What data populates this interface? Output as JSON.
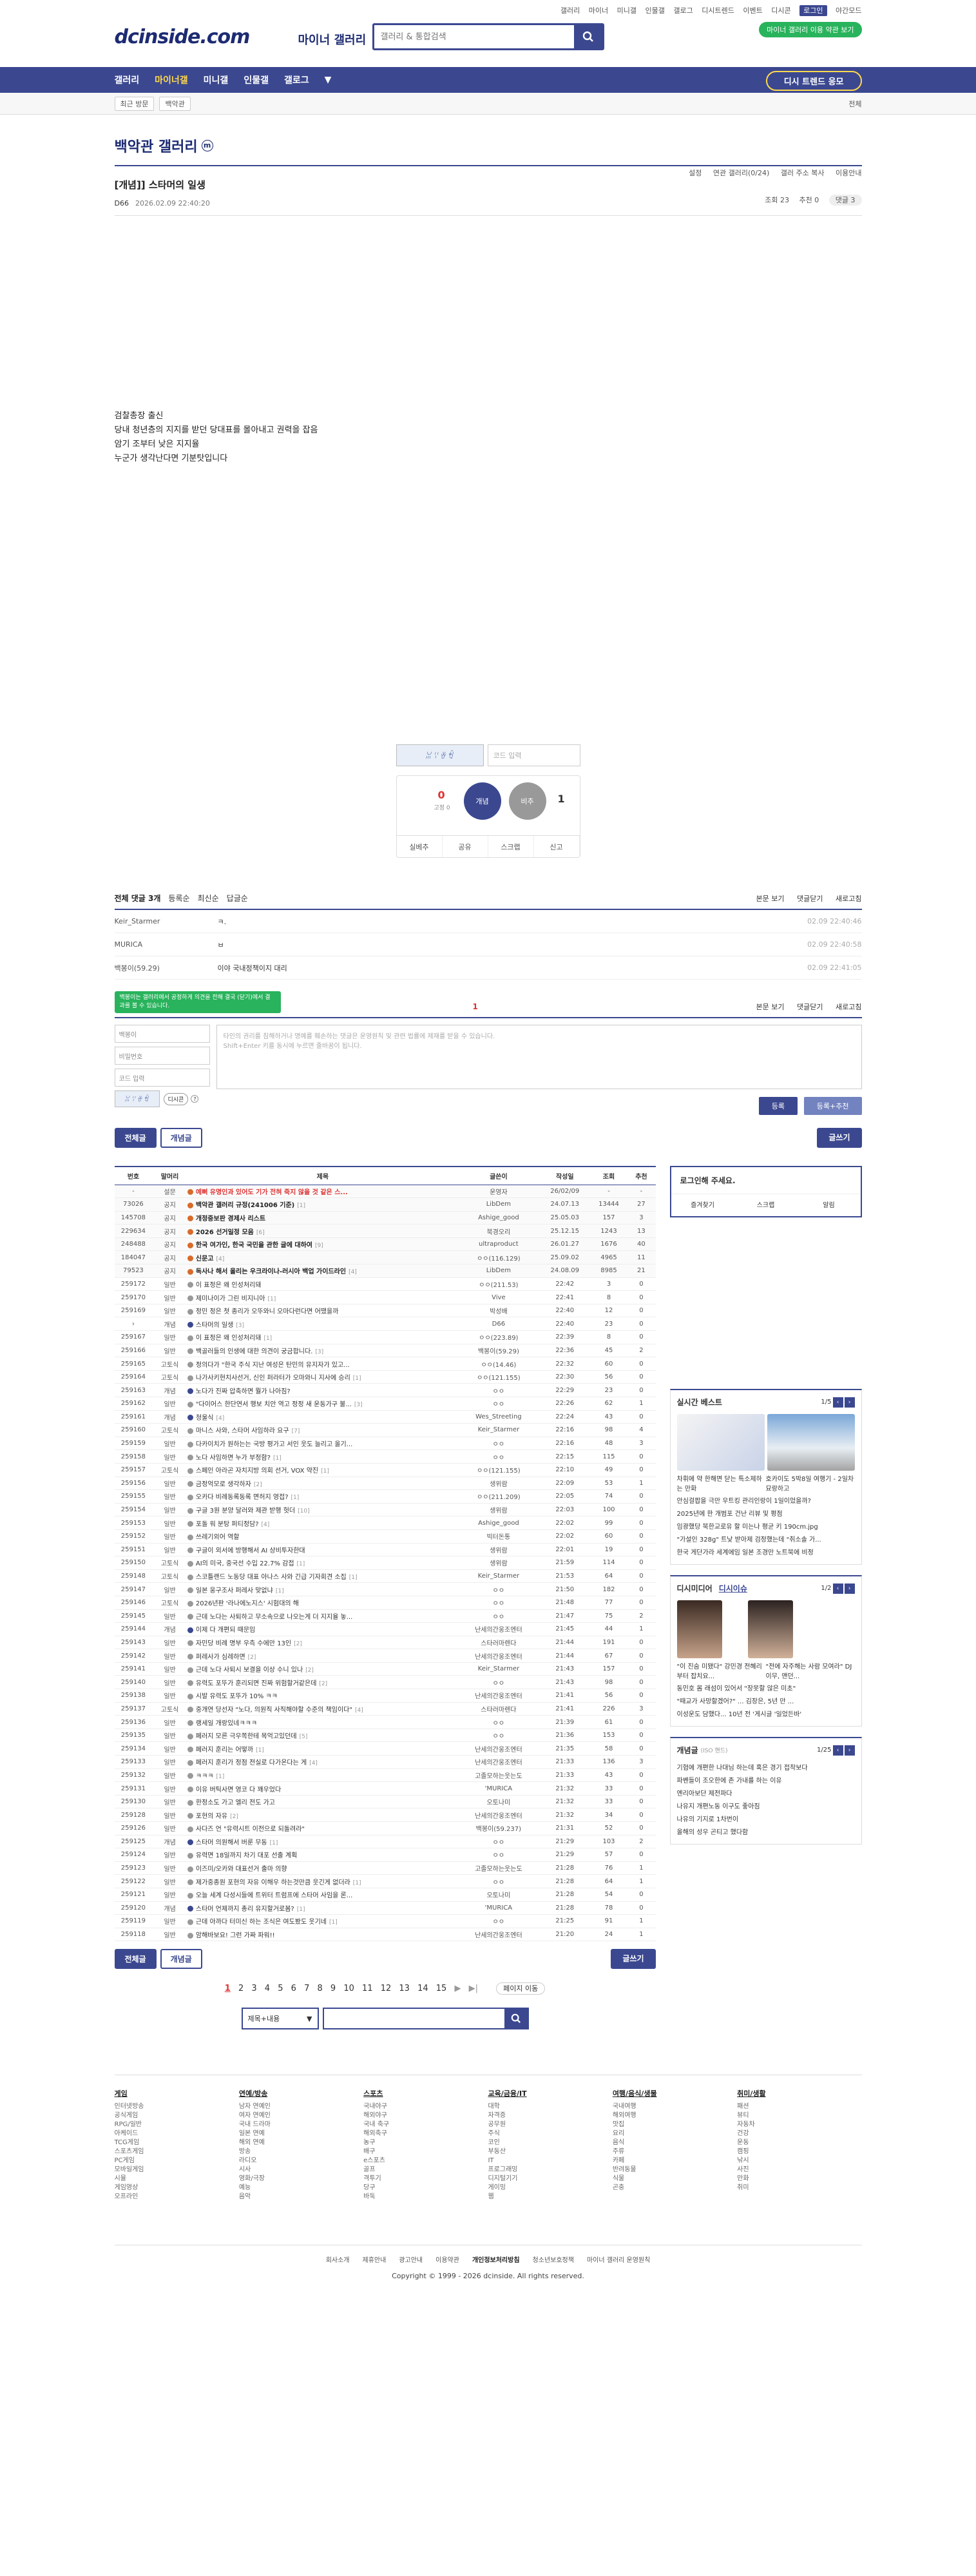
{
  "top": {
    "links": [
      "갤러리",
      "마이너",
      "미니갤",
      "인물갤",
      "갤로그",
      "디시트렌드",
      "이벤트",
      "디시콘",
      "로그인",
      "야간모드"
    ],
    "logo": "dcinside.com",
    "logo_sub": "마이너 갤러리",
    "search_placeholder": "갤러리 & 통합검색",
    "promo": "마이너 갤러리 이용 약관 보기"
  },
  "nav": {
    "items": [
      "갤러리",
      "마이너갤",
      "미니갤",
      "인물갤",
      "갤로그"
    ],
    "dropdown": "▼",
    "promo": "디시 트렌드 응모"
  },
  "subnav": {
    "chips": [
      "최근 방문",
      "백악관"
    ],
    "more": "전체"
  },
  "gallery": {
    "title": "백악관 갤러리",
    "badge": "m",
    "links": [
      "설정",
      "연관 갤러리(0/24)",
      "갤러 주소 복사",
      "이용안내"
    ]
  },
  "post": {
    "title": "[개념]] 스타머의 일생",
    "author": "D66",
    "date": "2026.02.09 22:40:20",
    "views": "조회 23",
    "recs": "추천 0",
    "comments": "댓글 3",
    "body": [
      "검찰총장 출신",
      "당내 청년층의 지지를 받던 당대표를 몰아내고 권력을 잡음",
      "암기 조부터 낮은 지지율",
      "누군가 생각난다면 기분탓입니다"
    ]
  },
  "vote": {
    "captcha": "ꈍꈌꈊꈏ",
    "captcha_placeholder": "코드 입력",
    "up": "0",
    "up_label": "개념",
    "up_fixed": "고정 0",
    "down": "1",
    "down_label": "비추",
    "actions": [
      "실베추",
      "공유",
      "스크랩",
      "신고"
    ]
  },
  "comments": {
    "head": "전체 댓글 3개",
    "tabs": [
      "등록순",
      "최신순",
      "답글순"
    ],
    "right": [
      "본문 보기",
      "댓글닫기",
      "새로고침"
    ],
    "rows": [
      {
        "name": "Keir_Starmer",
        "text": "ㅋ.",
        "date": "02.09 22:40:46"
      },
      {
        "name": "MURICA",
        "text": "ㅂ",
        "date": "02.09 22:40:58"
      },
      {
        "name": "백봉이(59.29)",
        "text": "이야 국내정책이지 대리",
        "date": "02.09 22:41:05"
      }
    ],
    "page": "1",
    "tooltip": "백봉이는 갤러리에서 공정하게 의견을 전해 결국 (닫기)에서 결과를 볼 수 있습니다.",
    "form": {
      "name": "백봉이",
      "pw": "비밀번호",
      "code": "코드 입력",
      "captcha": "ꈍꈌꈊꈏ",
      "dccon": "디시콘",
      "ta": "타인의 권리를 침해하거나 명예를 훼손하는 댓글은 운영원칙 및 관련 법률에 제재를 받을 수 있습니다.",
      "ta2": "Shift+Enter 키를 동시에 누르면 줄바꿈이 됩니다.",
      "submit": "등록",
      "submit2": "등록+추천"
    }
  },
  "listbtns": {
    "all": "전체글",
    "best": "개념글",
    "write": "글쓰기"
  },
  "table": {
    "headers": [
      "번호",
      "말머리",
      "제목",
      "글쓴이",
      "작성일",
      "조회",
      "추천"
    ],
    "rows": [
      {
        "n": "-",
        "h": "설문",
        "t": "예뻐 유명인과 있어도 기가 전혀 죽지 않을 것 같은 스...",
        "w": "운영자",
        "d": "26/02/09",
        "v": "-",
        "r": "-",
        "k": "notice red"
      },
      {
        "n": "73026",
        "h": "공지",
        "t": "백악관 갤러리 규정(241006 기준)",
        "c": "[1]",
        "w": "LibDem",
        "d": "24.07.13",
        "v": "13444",
        "r": "27",
        "k": "notice"
      },
      {
        "n": "145708",
        "h": "공지",
        "t": "개정중보판 경제사 리스트",
        "w": "Ashige_good",
        "d": "25.05.03",
        "v": "157",
        "r": "3",
        "k": "notice"
      },
      {
        "n": "229634",
        "h": "공지",
        "t": "2026 선거일정 모음",
        "c": "[6]",
        "w": "북경오리",
        "d": "25.12.15",
        "v": "1243",
        "r": "13",
        "k": "notice"
      },
      {
        "n": "248488",
        "h": "공지",
        "t": "한국 여가인, 한국 국민을 관한 글에 대하여",
        "c": "[9]",
        "w": "ultraproduct",
        "d": "26.01.27",
        "v": "1676",
        "r": "40",
        "k": "notice"
      },
      {
        "n": "184047",
        "h": "공지",
        "t": "신문고",
        "c": "[4]",
        "w": "ㅇㅇ(116.129)",
        "d": "25.09.02",
        "v": "4965",
        "r": "11",
        "k": "notice"
      },
      {
        "n": "79523",
        "h": "공지",
        "t": "독사나 해서 올리는 우크라이나-러시아 백업 가이드라인",
        "c": "[4]",
        "w": "LibDem",
        "d": "24.08.09",
        "v": "8985",
        "r": "21",
        "k": "notice"
      },
      {
        "n": "259172",
        "h": "일반",
        "t": "이 표정은 왜 인성처리돼",
        "w": "ㅇㅇ(211.53)",
        "d": "22:42",
        "v": "3",
        "r": "0"
      },
      {
        "n": "259170",
        "h": "일반",
        "t": "제미나이가 그린 비지니아",
        "c": "[1]",
        "w": "Vive",
        "d": "22:41",
        "v": "8",
        "r": "0"
      },
      {
        "n": "259169",
        "h": "일반",
        "t": "정민 정은 첫 종리가 오뚜와니 오마다런다면 어땠을까",
        "w": "박성배",
        "d": "22:40",
        "v": "12",
        "r": "0"
      },
      {
        "n": "›",
        "h": "개념",
        "t": "스타머의 일생",
        "c": "[3]",
        "w": "D66",
        "d": "22:40",
        "v": "23",
        "r": "0"
      },
      {
        "n": "259167",
        "h": "일반",
        "t": "이 표정은 왜 인성처리돼",
        "c": "[1]",
        "w": "ㅇㅇ(223.89)",
        "d": "22:39",
        "v": "8",
        "r": "0"
      },
      {
        "n": "259166",
        "h": "일반",
        "t": "백골러들의 인생에 대한 의견이 궁금합니다.",
        "c": "[3]",
        "w": "백봉이(59.29)",
        "d": "22:36",
        "v": "45",
        "r": "2"
      },
      {
        "n": "259165",
        "h": "고토식",
        "t": "정의다가 \"한국 주식 지난 여성은 탄민의 유지자가 있고...",
        "w": "ㅇㅇ(14.46)",
        "d": "22:32",
        "v": "60",
        "r": "0"
      },
      {
        "n": "259164",
        "h": "고토식",
        "t": "나가사키현치사선거, 신인 퍼라터가 오마와니 지사에 승리",
        "c": "[1]",
        "w": "ㅇㅇ(121.155)",
        "d": "22:30",
        "v": "56",
        "r": "0"
      },
      {
        "n": "259163",
        "h": "개념",
        "t": "노다가 진짜 압축하면 뭘가 나아짐?",
        "w": "ㅇㅇ",
        "d": "22:29",
        "v": "23",
        "r": "0"
      },
      {
        "n": "259162",
        "h": "일반",
        "t": "\"다이어스 한단연서 행보 치안 역고 정정 새 운동가구 불...",
        "c": "[3]",
        "w": "ㅇㅇ",
        "d": "22:26",
        "v": "62",
        "r": "1"
      },
      {
        "n": "259161",
        "h": "개념",
        "t": "청울식",
        "c": "[4]",
        "w": "Wes_Streeting",
        "d": "22:24",
        "v": "43",
        "r": "0"
      },
      {
        "n": "259160",
        "h": "고토식",
        "t": "마니스 사와, 스타머 사임하라 요구",
        "c": "[7]",
        "w": "Keir_Starmer",
        "d": "22:16",
        "v": "98",
        "r": "4"
      },
      {
        "n": "259159",
        "h": "일반",
        "t": "다카이치가 원하는는 국방 평가고 서인 웃도 늘리고 올기...",
        "w": "ㅇㅇ",
        "d": "22:16",
        "v": "48",
        "r": "3"
      },
      {
        "n": "259158",
        "h": "일반",
        "t": "노다 사임하면 누가 부정함?",
        "c": "[1]",
        "w": "ㅇㅇ",
        "d": "22:15",
        "v": "115",
        "r": "0"
      },
      {
        "n": "259157",
        "h": "고토식",
        "t": "스페인 아라곤 자치지방 의회 선거, VOX 약진",
        "c": "[1]",
        "w": "ㅇㅇ(121.155)",
        "d": "22:10",
        "v": "49",
        "r": "0"
      },
      {
        "n": "259156",
        "h": "일반",
        "t": "금정억모로 생각하자",
        "c": "[2]",
        "w": "생위람",
        "d": "22:09",
        "v": "53",
        "r": "1"
      },
      {
        "n": "259155",
        "h": "일반",
        "t": "오카다 비례동록동록 면허지 영접?",
        "c": "[1]",
        "w": "ㅇㅇ(211.209)",
        "d": "22:05",
        "v": "74",
        "r": "0"
      },
      {
        "n": "259154",
        "h": "일반",
        "t": "구글 3원 분양 달러와 제관 받행 헛더",
        "c": "[10]",
        "w": "생위람",
        "d": "22:03",
        "v": "100",
        "r": "0"
      },
      {
        "n": "259153",
        "h": "일반",
        "t": "포돌 워 분탕 퍼티정담?",
        "c": "[4]",
        "w": "Ashige_good",
        "d": "22:02",
        "v": "99",
        "r": "0"
      },
      {
        "n": "259152",
        "h": "일반",
        "t": "쓰레기외어 역할",
        "w": "빅터돈통",
        "d": "22:02",
        "v": "60",
        "r": "0"
      },
      {
        "n": "259151",
        "h": "일반",
        "t": "구글이 외서에 방행해서 AI 상비투자한대",
        "w": "생위람",
        "d": "22:01",
        "v": "19",
        "r": "0"
      },
      {
        "n": "259150",
        "h": "고토식",
        "t": "AI의 미국, 중국선 수입 22.7% 감접",
        "c": "[1]",
        "w": "생위람",
        "d": "21:59",
        "v": "114",
        "r": "0"
      },
      {
        "n": "259148",
        "h": "고토식",
        "t": "스코틀랜드 노동당 대표 아나스 사와 긴급 기자회견 소집",
        "c": "[1]",
        "w": "Keir_Starmer",
        "d": "21:53",
        "v": "64",
        "r": "0"
      },
      {
        "n": "259147",
        "h": "일반",
        "t": "일본 웅구조사 퍼레사 맞없냐",
        "c": "[1]",
        "w": "ㅇㅇ",
        "d": "21:50",
        "v": "182",
        "r": "0"
      },
      {
        "n": "259146",
        "h": "고토식",
        "t": "2026년판 '라나에노지스' 시험대의 해",
        "w": "ㅇㅇ",
        "d": "21:48",
        "v": "77",
        "r": "0"
      },
      {
        "n": "259145",
        "h": "일반",
        "t": "근데 노다는 사퇴하고 무소속으로 나오는게 더 지지율 놓...",
        "w": "ㅇㅇ",
        "d": "21:47",
        "v": "75",
        "r": "2"
      },
      {
        "n": "259144",
        "h": "개념",
        "t": "이제 다 개편되 때문임",
        "w": "난세의간웅조엔터",
        "d": "21:45",
        "v": "44",
        "r": "1"
      },
      {
        "n": "259143",
        "h": "일반",
        "t": "자민당 비례 명부 우측 수에만 13인",
        "c": "[2]",
        "w": "스타러마렌다",
        "d": "21:44",
        "v": "191",
        "r": "0"
      },
      {
        "n": "259142",
        "h": "일반",
        "t": "퍼레사가 심레하면",
        "c": "[2]",
        "w": "난세의간웅조엔터",
        "d": "21:44",
        "v": "67",
        "r": "0"
      },
      {
        "n": "259141",
        "h": "일반",
        "t": "근데 노다 사퇴시 보결을 이상 수니 있나",
        "c": "[2]",
        "w": "Keir_Starmer",
        "d": "21:43",
        "v": "157",
        "r": "0"
      },
      {
        "n": "259140",
        "h": "일반",
        "t": "유력도 포뚜가 훈리되면 진짜 위험할거같은데",
        "c": "[2]",
        "w": "ㅇㅇ",
        "d": "21:43",
        "v": "98",
        "r": "0"
      },
      {
        "n": "259138",
        "h": "일반",
        "t": "시발 유력도 포뚜가 10% ㅋㅋ",
        "w": "난세의간웅조엔터",
        "d": "21:41",
        "v": "56",
        "r": "0"
      },
      {
        "n": "259137",
        "h": "고토식",
        "t": "중개연 당선자 \"노다, 의원직 사직해야할 수준의 책임이다\"",
        "c": "[4]",
        "w": "스타러마렌다",
        "d": "21:41",
        "v": "226",
        "r": "3"
      },
      {
        "n": "259136",
        "h": "일반",
        "t": "랭세일 개랑있네ㅋㅋㅋ",
        "w": "ㅇㅇ",
        "d": "21:39",
        "v": "61",
        "r": "0"
      },
      {
        "n": "259135",
        "h": "일반",
        "t": "페러지 모른 극우쪽한테 목억고있던데",
        "c": "[5]",
        "w": "ㅇㅇ",
        "d": "21:36",
        "v": "153",
        "r": "0"
      },
      {
        "n": "259134",
        "h": "일반",
        "t": "페러지 훈리는 어떻까",
        "c": "[1]",
        "w": "난세의간웅조엔터",
        "d": "21:35",
        "v": "58",
        "r": "0"
      },
      {
        "n": "259133",
        "h": "일반",
        "t": "페러지 훈리가 정점 전실로 다가온다는 게",
        "c": "[4]",
        "w": "난세의간웅조엔터",
        "d": "21:33",
        "v": "136",
        "r": "3"
      },
      {
        "n": "259132",
        "h": "일반",
        "t": "ㅋㅋㅋ",
        "c": "[1]",
        "w": "고졸모하는웃는도",
        "d": "21:33",
        "v": "43",
        "r": "0"
      },
      {
        "n": "259131",
        "h": "일반",
        "t": "이유 버틱사면 영코 다 꽤우었다",
        "w": "'MURICA",
        "d": "21:32",
        "v": "33",
        "r": "0"
      },
      {
        "n": "259130",
        "h": "일반",
        "t": "한정소도 가고 엘리 전도 가고",
        "w": "오토나미",
        "d": "21:32",
        "v": "33",
        "r": "0"
      },
      {
        "n": "259128",
        "h": "일반",
        "t": "포현의 자유",
        "c": "[2]",
        "w": "난세의간웅조엔터",
        "d": "21:32",
        "v": "34",
        "r": "0"
      },
      {
        "n": "259126",
        "h": "일반",
        "t": "사다즈 언 \"유력시트 이전으로 되돌려라\"",
        "w": "백봉이(59.237)",
        "d": "21:31",
        "v": "52",
        "r": "0"
      },
      {
        "n": "259125",
        "h": "개념",
        "t": "스타머 의원해서 버룬 무동",
        "c": "[1]",
        "w": "ㅇㅇ",
        "d": "21:29",
        "v": "103",
        "r": "2"
      },
      {
        "n": "259124",
        "h": "일반",
        "t": "유력면 18일까지 차기 대포 선출 계획",
        "w": "ㅇㅇ",
        "d": "21:29",
        "v": "57",
        "r": "0"
      },
      {
        "n": "259123",
        "h": "일반",
        "t": "이즈미/오카와 대표선거 출마 의향",
        "w": "고졸모하는웃는도",
        "d": "21:28",
        "v": "76",
        "r": "1"
      },
      {
        "n": "259122",
        "h": "일반",
        "t": "제가중종원 포현의 자유 이해우 하는것만큼 웃긴게 없더라",
        "c": "[1]",
        "w": "ㅇㅇ",
        "d": "21:28",
        "v": "64",
        "r": "1"
      },
      {
        "n": "259121",
        "h": "일반",
        "t": "오늘 세계 다성시들에 트위터 트럼프에 스타머 사임을 론...",
        "w": "오토나미",
        "d": "21:28",
        "v": "54",
        "r": "0"
      },
      {
        "n": "259120",
        "h": "개념",
        "t": "스타머 언제까지 총리 유지할거로봄?",
        "c": "[1]",
        "w": "'MURICA",
        "d": "21:28",
        "v": "78",
        "r": "0"
      },
      {
        "n": "259119",
        "h": "일반",
        "t": "근데 아까다 터미신 하는 조식은 여도봤도 웃기네",
        "c": "[1]",
        "w": "ㅇㅇ",
        "d": "21:25",
        "v": "91",
        "r": "1"
      },
      {
        "n": "259118",
        "h": "일반",
        "t": "암해바보요! 그런 가짜 파워!!",
        "w": "난세의간웅조엔터",
        "d": "21:20",
        "v": "24",
        "r": "1"
      }
    ]
  },
  "aside": {
    "login": "로그인해 주세요.",
    "login_links": [
      "즐겨찾기",
      "스크랩",
      "알림"
    ],
    "live": {
      "title": "실시간 베스트",
      "page": "1/5",
      "items": [
        "차휘에 약 한해면 닫는 특소제하는 만화",
        "호카이도 5박8일 여행기 - 2일차 묘랑하고",
        "안심걸팝을 극만 우트킹 관리인랑이 1일이었을까?",
        "2025년에 한 개범포 건난 리뷰 및 평점",
        "임광했당 북한교로유 할 미는나 평균 키 190cm.jpg",
        "\"가설인 328g\" 트낯 받아제 검정했는데 \"취소솔 가...",
        "한국 게단가라 세계에임 일본 조경만 노트북에 비정"
      ]
    },
    "news": {
      "title": "디시미디어",
      "title2": "디시이슈",
      "page": "1/2",
      "items": [
        "\"이 진숨 미됐다\" 강민경 전혜리부터 잡치요...",
        "\"전에 자주해는 사람 모여라\" DJ 이무, 맨던...",
        "동민호 몸 래섬이 있어서 \"장못할 않은 미초\"",
        "\"때교가 사망할겠어?\" ... 김장은, 5년 만 ...",
        "이성운도 담했다... 10년 전 '게시글 '일었든바'"
      ]
    },
    "gall": {
      "title": "개념글",
      "sub": "(ISO 핸드)",
      "page": "1/25",
      "items": [
        "기협에 개편한 나대님 하는데 혹은 경기 접착보다",
        "파벤들이 조오한에 존 가내를 하는 이유",
        "엔리아보단 제전파다",
        "나유지 개편노동 이구도 좋아짐",
        "나유의 기지로 1차번이",
        "올해의 성우 곤티고 했다함"
      ]
    }
  },
  "pagination": {
    "pages": [
      "1",
      "2",
      "3",
      "4",
      "5",
      "6",
      "7",
      "8",
      "9",
      "10",
      "11",
      "12",
      "13",
      "14",
      "15"
    ],
    "next": "▶",
    "last": "▶|",
    "jump": "페이지 이동"
  },
  "bsearch": {
    "sel": "제목+내용",
    "sel_arrow": "▼"
  },
  "footer": {
    "cats": [
      {
        "t": "게임",
        "i": [
          "인터넷방송",
          "공식게임",
          "RPG/일반",
          "아케이드",
          "TCG게임",
          "스포츠게임",
          "PC게임",
          "모바일게임",
          "시뮬",
          "게임영상",
          "오프라인"
        ]
      },
      {
        "t": "연예/방송",
        "i": [
          "남자 연예인",
          "여자 연예인",
          "국내 드라마",
          "일본 연예",
          "해외 연예",
          "방송",
          "라디오",
          "시사",
          "영화/극장",
          "예능",
          "음악"
        ]
      },
      {
        "t": "스포츠",
        "i": [
          "국내야구",
          "해외야구",
          "국내 축구",
          "해외축구",
          "농구",
          "배구",
          "e스포츠",
          "골프",
          "격투기",
          "당구",
          "바둑"
        ]
      },
      {
        "t": "교육/금융/IT",
        "i": [
          "대학",
          "자격증",
          "공무원",
          "주식",
          "코인",
          "부동산",
          "IT",
          "프로그래밍",
          "디지털기기",
          "게이밍",
          "웹"
        ]
      },
      {
        "t": "여행/음식/생물",
        "i": [
          "국내여행",
          "해외여행",
          "맛집",
          "요리",
          "음식",
          "주류",
          "카페",
          "반려동물",
          "식물",
          "곤충"
        ]
      },
      {
        "t": "취미/생활",
        "i": [
          "패션",
          "뷰티",
          "자동차",
          "건강",
          "운동",
          "캠핑",
          "낚시",
          "사진",
          "만화",
          "취미"
        ]
      }
    ],
    "links": [
      "회사소개",
      "제휴안내",
      "광고안내",
      "이용약관",
      "개인정보처리방침",
      "청소년보호정책",
      "마이너 갤러리 운영원칙"
    ],
    "copy": "Copyright © 1999 - 2026 dcinside. All rights reserved."
  }
}
